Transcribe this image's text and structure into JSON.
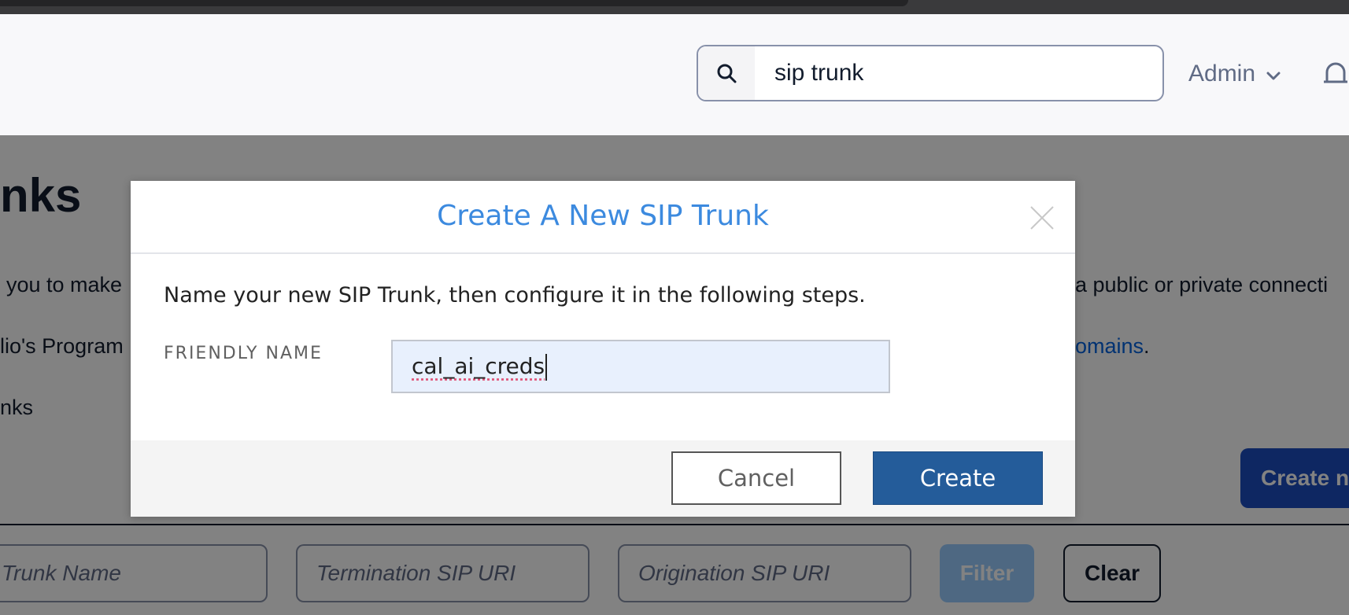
{
  "header": {
    "search": {
      "value": "sip trunk",
      "icon": "search-icon"
    },
    "admin_label": "Admin",
    "admin_icon": "chevron-down-icon",
    "notifications_icon": "bell-icon"
  },
  "page": {
    "title_fragment": "nks",
    "line1_left": "you to make",
    "line1_right": "a public or private connecti",
    "line2_left": "lio's Program",
    "line2_link": "omains",
    "line2_period": ".",
    "line3_left": "nks",
    "create_new_label": "Create n",
    "filters": {
      "trunk_name_placeholder": "Trunk Name",
      "termination_placeholder": "Termination SIP URI",
      "origination_placeholder": "Origination SIP URI",
      "filter_label": "Filter",
      "clear_label": "Clear"
    }
  },
  "modal": {
    "title": "Create A New SIP Trunk",
    "description": "Name your new SIP Trunk, then configure it in the following steps.",
    "field_label": "FRIENDLY NAME",
    "field_value": "cal_ai_creds",
    "cancel_label": "Cancel",
    "create_label": "Create"
  },
  "colors": {
    "modal_title": "#3c8adf",
    "create_button": "#245c9a",
    "create_new_button": "#1d4dc1",
    "link": "#0263e0",
    "overlay": "rgba(0,0,0,0.49)"
  }
}
